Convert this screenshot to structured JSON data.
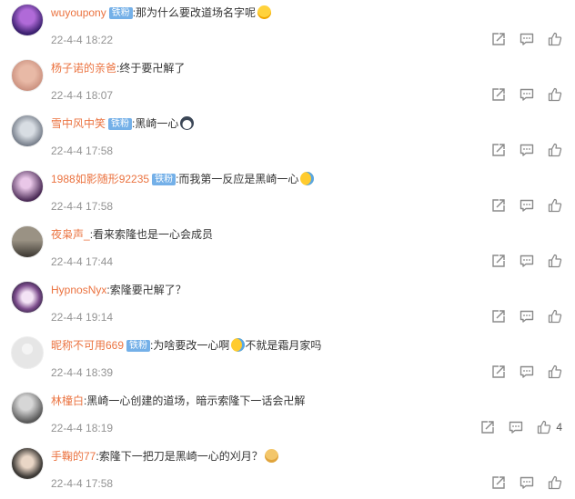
{
  "comments": [
    {
      "user": "wuyoupony",
      "badge": "铁粉",
      "text": ":那为什么要改道场名字呢",
      "emoji": "sweat-emoji",
      "time": "22-4-4 18:22",
      "likes": ""
    },
    {
      "user": "杨子诺的亲爸",
      "badge": "",
      "text": ":终于要卍解了",
      "emoji": "",
      "time": "22-4-4 18:07",
      "likes": ""
    },
    {
      "user": "雪中风中笑",
      "badge": "铁粉",
      "text": ":黑崎一心",
      "emoji": "husky-emoji",
      "time": "22-4-4 17:58",
      "likes": ""
    },
    {
      "user": "1988如影随形92235",
      "badge": "铁粉",
      "text": ":而我第一反应是黑崎一心",
      "emoji": "laugh-cry-emoji",
      "time": "22-4-4 17:58",
      "likes": ""
    },
    {
      "user": "夜枭声_",
      "badge": "",
      "text": ":看来索隆也是一心会成员",
      "emoji": "",
      "time": "22-4-4 17:44",
      "likes": ""
    },
    {
      "user": "HypnosNyx",
      "badge": "",
      "text": ":索隆要卍解了？",
      "emoji": "",
      "time": "22-4-4 19:14",
      "likes": ""
    },
    {
      "user": "昵称不可用669",
      "badge": "铁粉",
      "text": ":为啥要改一心啊",
      "emoji": "laugh-cry-emoji",
      "text2": "不就是霜月家吗",
      "time": "22-4-4 18:39",
      "likes": ""
    },
    {
      "user": "林橦白",
      "badge": "",
      "text": ":黑崎一心创建的道场，暗示索隆下一话会卍解",
      "emoji": "",
      "time": "22-4-4 18:19",
      "likes": "4"
    },
    {
      "user": "手鞠的77",
      "badge": "",
      "text": ":索隆下一把刀是黑崎一心的刈月？",
      "emoji": "doge-emoji",
      "time": "22-4-4 17:58",
      "likes": ""
    }
  ],
  "colors": {
    "username": "#eb7340",
    "badge": "#74b0e8",
    "time": "#939393",
    "icon": "#8a8a8a"
  },
  "icons": {
    "share": "share-icon",
    "comment": "comment-icon",
    "like": "like-icon"
  }
}
